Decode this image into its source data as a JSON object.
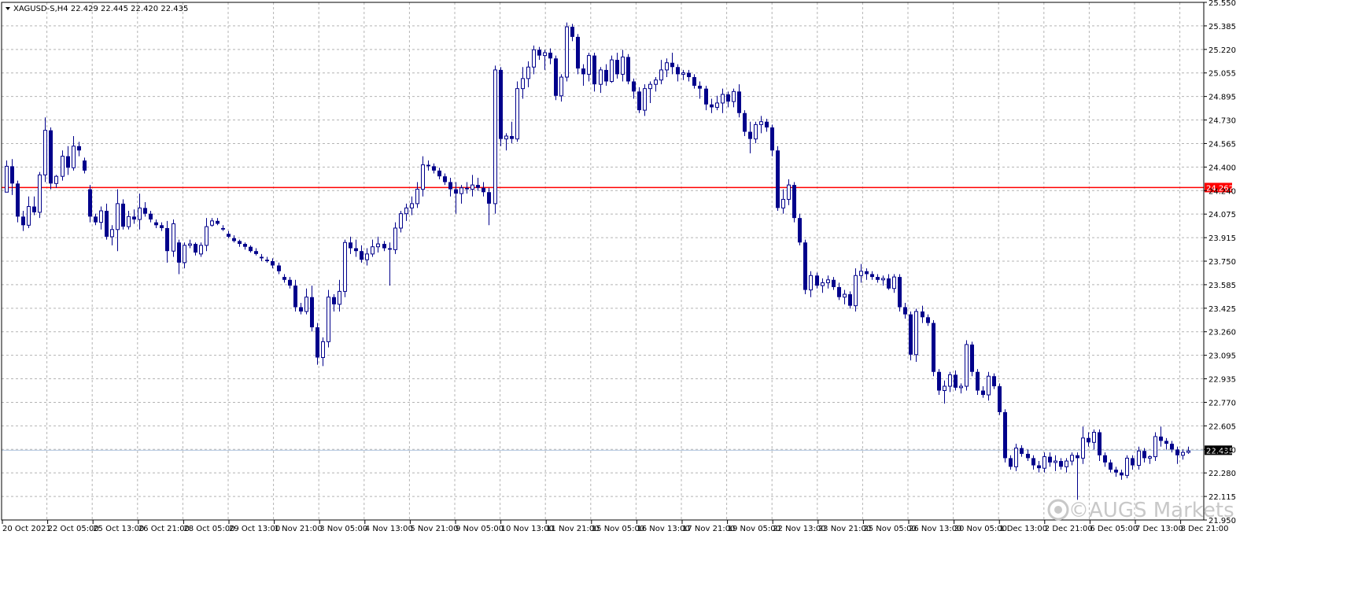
{
  "chart_data": {
    "type": "candlestick",
    "symbol_info": "XAGUSD-S,H4  22.429 22.445 22.420 22.435",
    "y_ticks": [
      "25.550",
      "25.385",
      "25.220",
      "25.055",
      "24.895",
      "24.730",
      "24.565",
      "24.400",
      "24.240",
      "24.075",
      "23.915",
      "23.750",
      "23.585",
      "23.425",
      "23.260",
      "23.095",
      "22.935",
      "22.770",
      "22.605",
      "22.440",
      "22.280",
      "22.115",
      "21.950"
    ],
    "x_labels": [
      "20 Oct 2021",
      "22 Oct 05:00",
      "25 Oct 13:00",
      "26 Oct 21:00",
      "28 Oct 05:00",
      "29 Oct 13:00",
      "1 Nov 21:00",
      "3 Nov 05:00",
      "4 Nov 13:00",
      "5 Nov 21:00",
      "9 Nov 05:00",
      "10 Nov 13:00",
      "11 Nov 21:00",
      "15 Nov 05:00",
      "16 Nov 13:00",
      "17 Nov 21:00",
      "19 Nov 05:00",
      "22 Nov 13:00",
      "23 Nov 21:00",
      "25 Nov 05:00",
      "26 Nov 13:00",
      "30 Nov 05:00",
      "1 Dec 13:00",
      "2 Dec 21:00",
      "6 Dec 05:00",
      "7 Dec 13:00",
      "8 Dec 21:00"
    ],
    "ylim": [
      21.95,
      25.55
    ],
    "horizontal_lines": [
      {
        "value": 24.262,
        "label": "24.262",
        "color": "#ff0000"
      },
      {
        "value": 22.435,
        "label": "22.435",
        "color": "#b0c4de"
      }
    ],
    "colors": {
      "candle": "#00008b",
      "grid": "#b4b4b4",
      "border": "#000000",
      "watermark": "#c8c8c8"
    },
    "grid": true,
    "watermark": "©AUGS Markets",
    "ohlc": [
      [
        24.23,
        24.45,
        24.28,
        24.41
      ],
      [
        24.41,
        24.46,
        24.21,
        24.29
      ],
      [
        24.29,
        24.31,
        24.02,
        24.06
      ],
      [
        24.06,
        24.1,
        23.96,
        24.0
      ],
      [
        24.0,
        24.2,
        23.98,
        24.13
      ],
      [
        24.13,
        24.2,
        24.07,
        24.09
      ],
      [
        24.09,
        24.37,
        24.05,
        24.35
      ],
      [
        24.35,
        24.75,
        24.3,
        24.66
      ],
      [
        24.66,
        24.68,
        24.25,
        24.29
      ],
      [
        24.29,
        24.35,
        24.26,
        24.34
      ],
      [
        24.34,
        24.52,
        24.31,
        24.48
      ],
      [
        24.48,
        24.55,
        24.35,
        24.4
      ],
      [
        24.4,
        24.62,
        24.38,
        24.55
      ],
      [
        24.55,
        24.58,
        24.48,
        24.52
      ],
      [
        24.45,
        24.47,
        24.36,
        24.38
      ],
      [
        24.25,
        24.28,
        24.02,
        24.06
      ],
      [
        24.06,
        24.08,
        24.0,
        24.02
      ],
      [
        24.02,
        24.13,
        23.97,
        24.1
      ],
      [
        24.1,
        24.15,
        23.9,
        23.92
      ],
      [
        23.92,
        24.0,
        23.86,
        23.97
      ],
      [
        23.97,
        24.25,
        23.82,
        24.15
      ],
      [
        24.15,
        24.18,
        23.97,
        23.99
      ],
      [
        23.99,
        24.1,
        23.97,
        24.06
      ],
      [
        24.06,
        24.11,
        24.01,
        24.04
      ],
      [
        24.04,
        24.22,
        23.97,
        24.12
      ],
      [
        24.12,
        24.16,
        24.06,
        24.08
      ],
      [
        24.08,
        24.1,
        24.02,
        24.04
      ],
      [
        24.02,
        24.04,
        23.98,
        24.0
      ],
      [
        24.0,
        24.02,
        23.96,
        23.98
      ],
      [
        23.98,
        24.03,
        23.74,
        23.82
      ],
      [
        23.82,
        24.04,
        23.78,
        24.01
      ],
      [
        23.88,
        23.9,
        23.66,
        23.74
      ],
      [
        23.74,
        23.88,
        23.7,
        23.86
      ],
      [
        23.86,
        23.9,
        23.84,
        23.87
      ],
      [
        23.87,
        23.88,
        23.79,
        23.81
      ],
      [
        23.8,
        23.88,
        23.78,
        23.86
      ],
      [
        23.86,
        24.05,
        23.82,
        23.99
      ],
      [
        24.0,
        24.05,
        23.99,
        24.03
      ],
      [
        24.03,
        24.05,
        24.0,
        24.01
      ],
      [
        23.98,
        24.0,
        23.96,
        23.97
      ],
      [
        23.94,
        23.96,
        23.91,
        23.92
      ],
      [
        23.91,
        23.93,
        23.88,
        23.89
      ],
      [
        23.89,
        23.9,
        23.85,
        23.87
      ],
      [
        23.87,
        23.88,
        23.83,
        23.85
      ],
      [
        23.85,
        23.86,
        23.81,
        23.82
      ],
      [
        23.82,
        23.84,
        23.79,
        23.8
      ],
      [
        23.78,
        23.8,
        23.75,
        23.77
      ],
      [
        23.76,
        23.78,
        23.74,
        23.75
      ],
      [
        23.75,
        23.77,
        23.7,
        23.72
      ],
      [
        23.72,
        23.74,
        23.66,
        23.68
      ],
      [
        23.64,
        23.66,
        23.6,
        23.62
      ],
      [
        23.62,
        23.64,
        23.56,
        23.58
      ],
      [
        23.58,
        23.62,
        23.4,
        23.43
      ],
      [
        23.43,
        23.46,
        23.38,
        23.4
      ],
      [
        23.4,
        23.56,
        23.38,
        23.5
      ],
      [
        23.5,
        23.58,
        23.26,
        23.29
      ],
      [
        23.29,
        23.32,
        23.03,
        23.08
      ],
      [
        23.08,
        23.22,
        23.02,
        23.19
      ],
      [
        23.19,
        23.55,
        23.15,
        23.5
      ],
      [
        23.5,
        23.52,
        23.4,
        23.45
      ],
      [
        23.45,
        23.62,
        23.4,
        23.54
      ],
      [
        23.54,
        23.9,
        23.5,
        23.88
      ],
      [
        23.88,
        23.92,
        23.8,
        23.84
      ],
      [
        23.84,
        23.9,
        23.78,
        23.82
      ],
      [
        23.82,
        23.86,
        23.74,
        23.76
      ],
      [
        23.76,
        23.84,
        23.72,
        23.8
      ],
      [
        23.8,
        23.9,
        23.78,
        23.85
      ],
      [
        23.85,
        23.92,
        23.81,
        23.87
      ],
      [
        23.87,
        23.89,
        23.82,
        23.84
      ],
      [
        23.84,
        23.88,
        23.58,
        23.83
      ],
      [
        23.83,
        24.02,
        23.8,
        23.98
      ],
      [
        23.98,
        24.1,
        23.95,
        24.08
      ],
      [
        24.08,
        24.15,
        24.03,
        24.12
      ],
      [
        24.12,
        24.2,
        24.07,
        24.15
      ],
      [
        24.15,
        24.3,
        24.12,
        24.25
      ],
      [
        24.25,
        24.48,
        24.2,
        24.42
      ],
      [
        24.42,
        24.45,
        24.38,
        24.41
      ],
      [
        24.41,
        24.43,
        24.36,
        24.38
      ],
      [
        24.38,
        24.4,
        24.32,
        24.34
      ],
      [
        24.34,
        24.36,
        24.28,
        24.3
      ],
      [
        24.3,
        24.33,
        24.2,
        24.25
      ],
      [
        24.25,
        24.3,
        24.08,
        24.22
      ],
      [
        24.22,
        24.28,
        24.15,
        24.26
      ],
      [
        24.26,
        24.3,
        24.22,
        24.25
      ],
      [
        24.25,
        24.35,
        24.2,
        24.28
      ],
      [
        24.28,
        24.33,
        24.24,
        24.26
      ],
      [
        24.26,
        24.3,
        24.2,
        24.23
      ],
      [
        24.23,
        24.26,
        24.0,
        24.15
      ],
      [
        24.15,
        25.11,
        24.08,
        25.08
      ],
      [
        25.08,
        25.1,
        24.55,
        24.6
      ],
      [
        24.6,
        24.64,
        24.52,
        24.62
      ],
      [
        24.62,
        24.72,
        24.57,
        24.6
      ],
      [
        24.6,
        25.0,
        24.58,
        24.95
      ],
      [
        24.95,
        25.1,
        24.88,
        25.02
      ],
      [
        25.02,
        25.14,
        24.96,
        25.1
      ],
      [
        25.1,
        25.25,
        25.05,
        25.22
      ],
      [
        25.22,
        25.24,
        25.15,
        25.18
      ],
      [
        25.18,
        25.22,
        25.08,
        25.2
      ],
      [
        25.2,
        25.23,
        25.12,
        25.16
      ],
      [
        25.16,
        25.18,
        24.87,
        24.9
      ],
      [
        24.9,
        25.05,
        24.86,
        25.03
      ],
      [
        25.03,
        25.41,
        25.0,
        25.38
      ],
      [
        25.38,
        25.4,
        25.28,
        25.31
      ],
      [
        25.31,
        25.33,
        25.05,
        25.09
      ],
      [
        25.09,
        25.12,
        24.97,
        25.05
      ],
      [
        25.05,
        25.2,
        25.0,
        25.18
      ],
      [
        25.18,
        25.2,
        24.93,
        24.98
      ],
      [
        24.98,
        25.1,
        24.92,
        25.08
      ],
      [
        25.08,
        25.12,
        24.97,
        25.0
      ],
      [
        25.0,
        25.18,
        24.99,
        25.15
      ],
      [
        25.15,
        25.2,
        25.02,
        25.05
      ],
      [
        25.05,
        25.22,
        25.0,
        25.17
      ],
      [
        25.17,
        25.19,
        24.98,
        25.0
      ],
      [
        25.0,
        25.02,
        24.88,
        24.93
      ],
      [
        24.93,
        24.96,
        24.78,
        24.8
      ],
      [
        24.8,
        24.98,
        24.76,
        24.95
      ],
      [
        24.95,
        25.0,
        24.85,
        24.98
      ],
      [
        24.98,
        25.03,
        24.93,
        25.01
      ],
      [
        25.01,
        25.15,
        24.98,
        25.08
      ],
      [
        25.08,
        25.16,
        25.03,
        25.13
      ],
      [
        25.13,
        25.2,
        25.05,
        25.1
      ],
      [
        25.1,
        25.12,
        25.0,
        25.05
      ],
      [
        25.05,
        25.08,
        25.01,
        25.06
      ],
      [
        25.06,
        25.08,
        25.0,
        25.03
      ],
      [
        25.03,
        25.05,
        24.95,
        24.97
      ],
      [
        24.97,
        25.0,
        24.88,
        24.95
      ],
      [
        24.95,
        24.97,
        24.8,
        24.84
      ],
      [
        24.84,
        24.88,
        24.78,
        24.82
      ],
      [
        24.82,
        24.9,
        24.8,
        24.85
      ],
      [
        24.85,
        24.95,
        24.78,
        24.91
      ],
      [
        24.91,
        24.93,
        24.82,
        24.86
      ],
      [
        24.86,
        24.95,
        24.82,
        24.93
      ],
      [
        24.93,
        24.98,
        24.75,
        24.78
      ],
      [
        24.78,
        24.8,
        24.62,
        24.65
      ],
      [
        24.65,
        24.72,
        24.5,
        24.6
      ],
      [
        24.6,
        24.72,
        24.57,
        24.7
      ],
      [
        24.7,
        24.76,
        24.64,
        24.72
      ],
      [
        24.72,
        24.74,
        24.65,
        24.68
      ],
      [
        24.68,
        24.7,
        24.48,
        24.52
      ],
      [
        24.52,
        24.55,
        24.1,
        24.12
      ],
      [
        24.12,
        24.25,
        24.08,
        24.18
      ],
      [
        24.18,
        24.32,
        24.14,
        24.28
      ],
      [
        24.28,
        24.3,
        24.02,
        24.05
      ],
      [
        24.05,
        24.08,
        23.86,
        23.88
      ],
      [
        23.88,
        23.9,
        23.52,
        23.55
      ],
      [
        23.55,
        23.68,
        23.5,
        23.65
      ],
      [
        23.65,
        23.67,
        23.56,
        23.58
      ],
      [
        23.58,
        23.63,
        23.53,
        23.6
      ],
      [
        23.6,
        23.65,
        23.56,
        23.62
      ],
      [
        23.62,
        23.64,
        23.55,
        23.57
      ],
      [
        23.57,
        23.6,
        23.48,
        23.5
      ],
      [
        23.5,
        23.55,
        23.45,
        23.52
      ],
      [
        23.52,
        23.54,
        23.42,
        23.44
      ],
      [
        23.44,
        23.7,
        23.4,
        23.65
      ],
      [
        23.65,
        23.73,
        23.6,
        23.68
      ],
      [
        23.68,
        23.7,
        23.62,
        23.66
      ],
      [
        23.66,
        23.68,
        23.62,
        23.64
      ],
      [
        23.64,
        23.66,
        23.6,
        23.62
      ],
      [
        23.62,
        23.65,
        23.58,
        23.63
      ],
      [
        23.63,
        23.66,
        23.55,
        23.56
      ],
      [
        23.56,
        23.66,
        23.53,
        23.64
      ],
      [
        23.64,
        23.66,
        23.4,
        23.43
      ],
      [
        23.43,
        23.46,
        23.35,
        23.38
      ],
      [
        23.38,
        23.4,
        23.06,
        23.1
      ],
      [
        23.1,
        23.42,
        23.05,
        23.4
      ],
      [
        23.4,
        23.44,
        23.32,
        23.36
      ],
      [
        23.36,
        23.38,
        23.3,
        23.32
      ],
      [
        23.32,
        23.34,
        22.95,
        22.98
      ],
      [
        22.98,
        23.0,
        22.82,
        22.85
      ],
      [
        22.85,
        22.92,
        22.76,
        22.88
      ],
      [
        22.88,
        22.98,
        22.84,
        22.96
      ],
      [
        22.96,
        22.99,
        22.85,
        22.87
      ],
      [
        22.87,
        22.9,
        22.83,
        22.88
      ],
      [
        22.88,
        23.2,
        22.85,
        23.17
      ],
      [
        23.17,
        23.19,
        22.95,
        22.98
      ],
      [
        22.98,
        23.0,
        22.82,
        22.85
      ],
      [
        22.85,
        22.88,
        22.8,
        22.82
      ],
      [
        22.82,
        22.98,
        22.78,
        22.95
      ],
      [
        22.95,
        22.97,
        22.86,
        22.88
      ],
      [
        22.88,
        22.9,
        22.68,
        22.7
      ],
      [
        22.7,
        22.72,
        22.35,
        22.38
      ],
      [
        22.38,
        22.4,
        22.3,
        22.32
      ],
      [
        22.32,
        22.48,
        22.29,
        22.45
      ],
      [
        22.45,
        22.47,
        22.39,
        22.41
      ],
      [
        22.41,
        22.44,
        22.36,
        22.38
      ],
      [
        22.38,
        22.4,
        22.3,
        22.33
      ],
      [
        22.33,
        22.36,
        22.28,
        22.31
      ],
      [
        22.31,
        22.42,
        22.28,
        22.39
      ],
      [
        22.39,
        22.42,
        22.32,
        22.35
      ],
      [
        22.35,
        22.4,
        22.29,
        22.36
      ],
      [
        22.36,
        22.38,
        22.3,
        22.32
      ],
      [
        22.32,
        22.38,
        22.28,
        22.36
      ],
      [
        22.36,
        22.42,
        22.33,
        22.4
      ],
      [
        22.4,
        22.42,
        22.09,
        22.38
      ],
      [
        22.38,
        22.6,
        22.34,
        22.52
      ],
      [
        22.52,
        22.56,
        22.46,
        22.49
      ],
      [
        22.49,
        22.58,
        22.44,
        22.56
      ],
      [
        22.56,
        22.58,
        22.36,
        22.4
      ],
      [
        22.4,
        22.42,
        22.32,
        22.35
      ],
      [
        22.35,
        22.37,
        22.28,
        22.3
      ],
      [
        22.3,
        22.32,
        22.25,
        22.28
      ],
      [
        22.28,
        22.3,
        22.23,
        22.26
      ],
      [
        22.26,
        22.4,
        22.24,
        22.38
      ],
      [
        22.38,
        22.4,
        22.3,
        22.33
      ],
      [
        22.33,
        22.46,
        22.3,
        22.43
      ],
      [
        22.43,
        22.45,
        22.35,
        22.38
      ],
      [
        22.38,
        22.4,
        22.34,
        22.39
      ],
      [
        22.39,
        22.56,
        22.36,
        22.53
      ],
      [
        22.53,
        22.6,
        22.46,
        22.5
      ],
      [
        22.5,
        22.52,
        22.44,
        22.48
      ],
      [
        22.48,
        22.5,
        22.42,
        22.44
      ],
      [
        22.44,
        22.46,
        22.34,
        22.4
      ],
      [
        22.4,
        22.44,
        22.37,
        22.42
      ],
      [
        22.42,
        22.46,
        22.41,
        22.43
      ]
    ]
  }
}
